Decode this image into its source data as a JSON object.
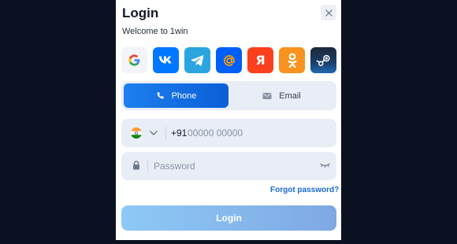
{
  "dialog": {
    "title": "Login",
    "subtitle": "Welcome to 1win"
  },
  "social_logins": [
    {
      "name": "google",
      "icon": "google-icon"
    },
    {
      "name": "vk",
      "icon": "vk-icon"
    },
    {
      "name": "telegram",
      "icon": "telegram-icon"
    },
    {
      "name": "mail-ru",
      "icon": "at-sign-icon"
    },
    {
      "name": "yandex",
      "icon": "yandex-icon",
      "glyph": "Я"
    },
    {
      "name": "odnoklassniki",
      "icon": "odnoklassniki-icon"
    },
    {
      "name": "steam",
      "icon": "steam-icon"
    }
  ],
  "tabs": {
    "phone_label": "Phone",
    "email_label": "Email",
    "active": "Phone"
  },
  "phone": {
    "country_flag": "india-flag-icon",
    "prefix": "+91",
    "placeholder": "00000 00000"
  },
  "password": {
    "placeholder": "Password"
  },
  "forgot_label": "Forgot password?",
  "login_button": "Login",
  "colors": {
    "accent": "#0b5fd6",
    "link": "#1769d6",
    "backdrop": "#0b1120"
  }
}
